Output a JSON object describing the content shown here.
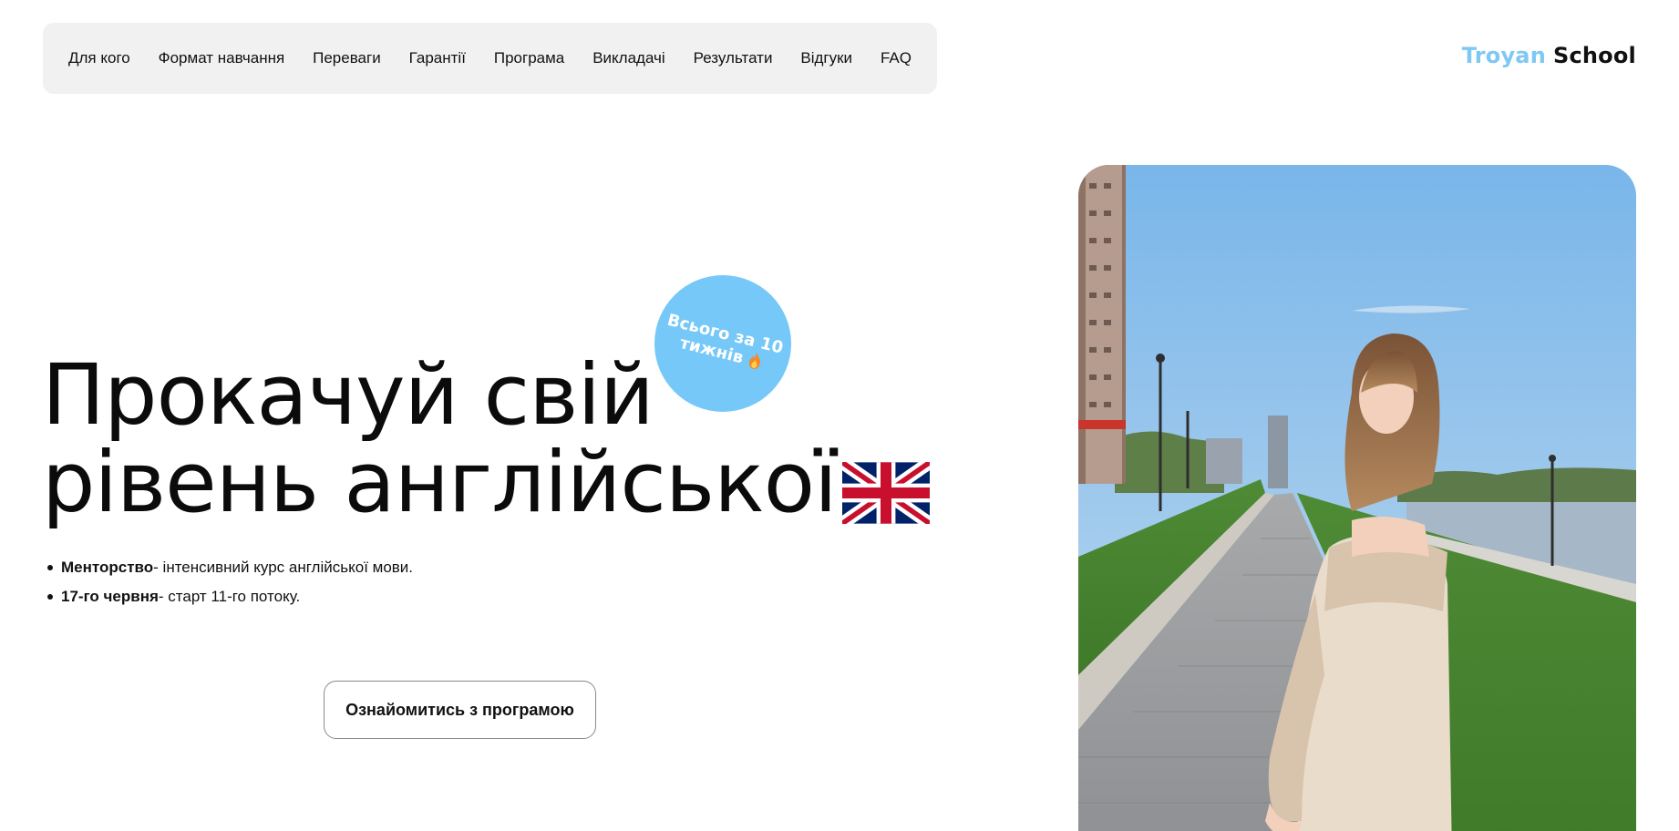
{
  "nav": {
    "items": [
      "Для кого",
      "Формат навчання",
      "Переваги",
      "Гарантії",
      "Програма",
      "Викладачі",
      "Результати",
      "Відгуки",
      "FAQ"
    ]
  },
  "logo": {
    "part1": "Troyan",
    "part2": "School"
  },
  "hero": {
    "title_line1": "Прокачуй свій",
    "title_line2": "рівень англійської"
  },
  "badge": {
    "line1": "Всього за 10",
    "line2": "тижнів"
  },
  "bullets": [
    {
      "bold": "Менторство",
      "text": " - інтенсивний курс англійської мови."
    },
    {
      "bold": "17-го червня",
      "text": " - старт 11-го потоку."
    }
  ],
  "cta": {
    "label": "Ознайомитись з програмою"
  },
  "colors": {
    "accent": "#76c8f8",
    "logo_accent": "#7ec8f4",
    "nav_bg": "#f1f1f1"
  },
  "icons": {
    "flag": "uk-flag-icon",
    "flame": "fire-icon"
  }
}
